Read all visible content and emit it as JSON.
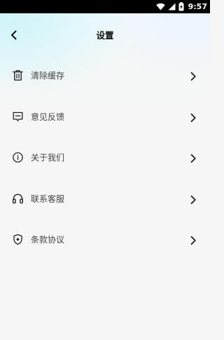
{
  "status_bar": {
    "time": "9:57",
    "battery_level": "charging",
    "icons": [
      "wifi-icon",
      "signal-icon",
      "battery-charging-icon"
    ]
  },
  "header": {
    "title": "设置",
    "back_icon": "chevron-left-icon"
  },
  "menu": {
    "items": [
      {
        "label": "清除缓存",
        "icon": "trash-icon"
      },
      {
        "label": "意见反馈",
        "icon": "feedback-message-icon"
      },
      {
        "label": "关于我们",
        "icon": "info-circle-icon"
      },
      {
        "label": "联系客服",
        "icon": "headphones-icon"
      },
      {
        "label": "条款协议",
        "icon": "shield-icon"
      }
    ],
    "chevron_icon": "chevron-right-icon"
  },
  "colors": {
    "status_bar": "#000000",
    "background": "#f6f6f6",
    "header_tint": "#cdf4fa",
    "text_primary": "#111111",
    "text_item": "#454545",
    "icon": "#222222"
  }
}
